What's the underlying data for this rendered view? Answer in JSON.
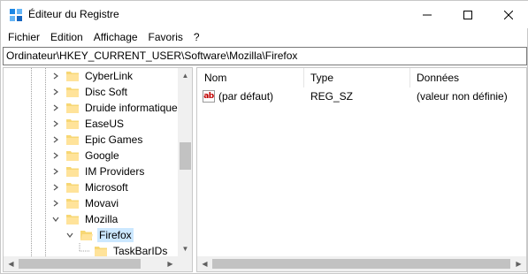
{
  "window": {
    "title": "Éditeur du Registre",
    "accent_color": "#0078d7"
  },
  "menu": [
    "Fichier",
    "Edition",
    "Affichage",
    "Favoris",
    "?"
  ],
  "address": "Ordinateur\\HKEY_CURRENT_USER\\Software\\Mozilla\\Firefox",
  "tree": {
    "items": [
      {
        "label": "CyberLink",
        "expanded": false
      },
      {
        "label": "Disc Soft",
        "expanded": false
      },
      {
        "label": "Druide informatique",
        "expanded": false
      },
      {
        "label": "EaseUS",
        "expanded": false
      },
      {
        "label": "Epic Games",
        "expanded": false
      },
      {
        "label": "Google",
        "expanded": false
      },
      {
        "label": "IM Providers",
        "expanded": false
      },
      {
        "label": "Microsoft",
        "expanded": false
      },
      {
        "label": "Movavi",
        "expanded": false
      },
      {
        "label": "Mozilla",
        "expanded": true
      },
      {
        "label": "Firefox",
        "expanded": true,
        "selected": true
      },
      {
        "label": "TaskBarIDs",
        "expanded": false
      }
    ]
  },
  "values": {
    "columns": [
      "Nom",
      "Type",
      "Données"
    ],
    "rows": [
      {
        "icon": "ab-string-icon",
        "icon_text": "ab",
        "name": "(par défaut)",
        "type": "REG_SZ",
        "data": "(valeur non définie)"
      }
    ]
  }
}
